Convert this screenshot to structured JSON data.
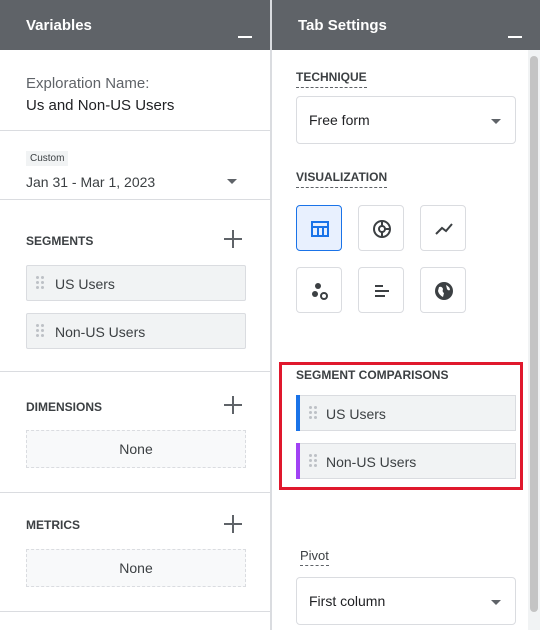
{
  "variables": {
    "title": "Variables",
    "exploration_name_label": "Exploration Name:",
    "exploration_name_value": "Us and Non-US Users",
    "date_tag": "Custom",
    "date_range": "Jan 31 - Mar 1, 2023",
    "segments_label": "SEGMENTS",
    "segments": [
      "US Users",
      "Non-US Users"
    ],
    "dimensions_label": "DIMENSIONS",
    "dimensions_empty": "None",
    "metrics_label": "METRICS",
    "metrics_empty": "None"
  },
  "tab_settings": {
    "title": "Tab Settings",
    "technique_label": "TECHNIQUE",
    "technique_value": "Free form",
    "visualization_label": "VISUALIZATION",
    "visualizations": [
      {
        "icon": "table-icon",
        "selected": true
      },
      {
        "icon": "donut-chart-icon",
        "selected": false
      },
      {
        "icon": "line-chart-icon",
        "selected": false
      },
      {
        "icon": "scatter-plot-icon",
        "selected": false
      },
      {
        "icon": "bar-chart-icon",
        "selected": false
      },
      {
        "icon": "geo-map-icon",
        "selected": false
      }
    ],
    "segment_comparisons_label": "SEGMENT COMPARISONS",
    "segment_comparisons": [
      {
        "label": "US Users",
        "color": "#1a73e8"
      },
      {
        "label": "Non-US Users",
        "color": "#a142f4"
      }
    ],
    "pivot_label": "Pivot",
    "pivot_value": "First column"
  },
  "colors": {
    "header_bg": "#5f6368",
    "selected_accent": "#1a73e8",
    "highlight_border": "#e0182d"
  }
}
